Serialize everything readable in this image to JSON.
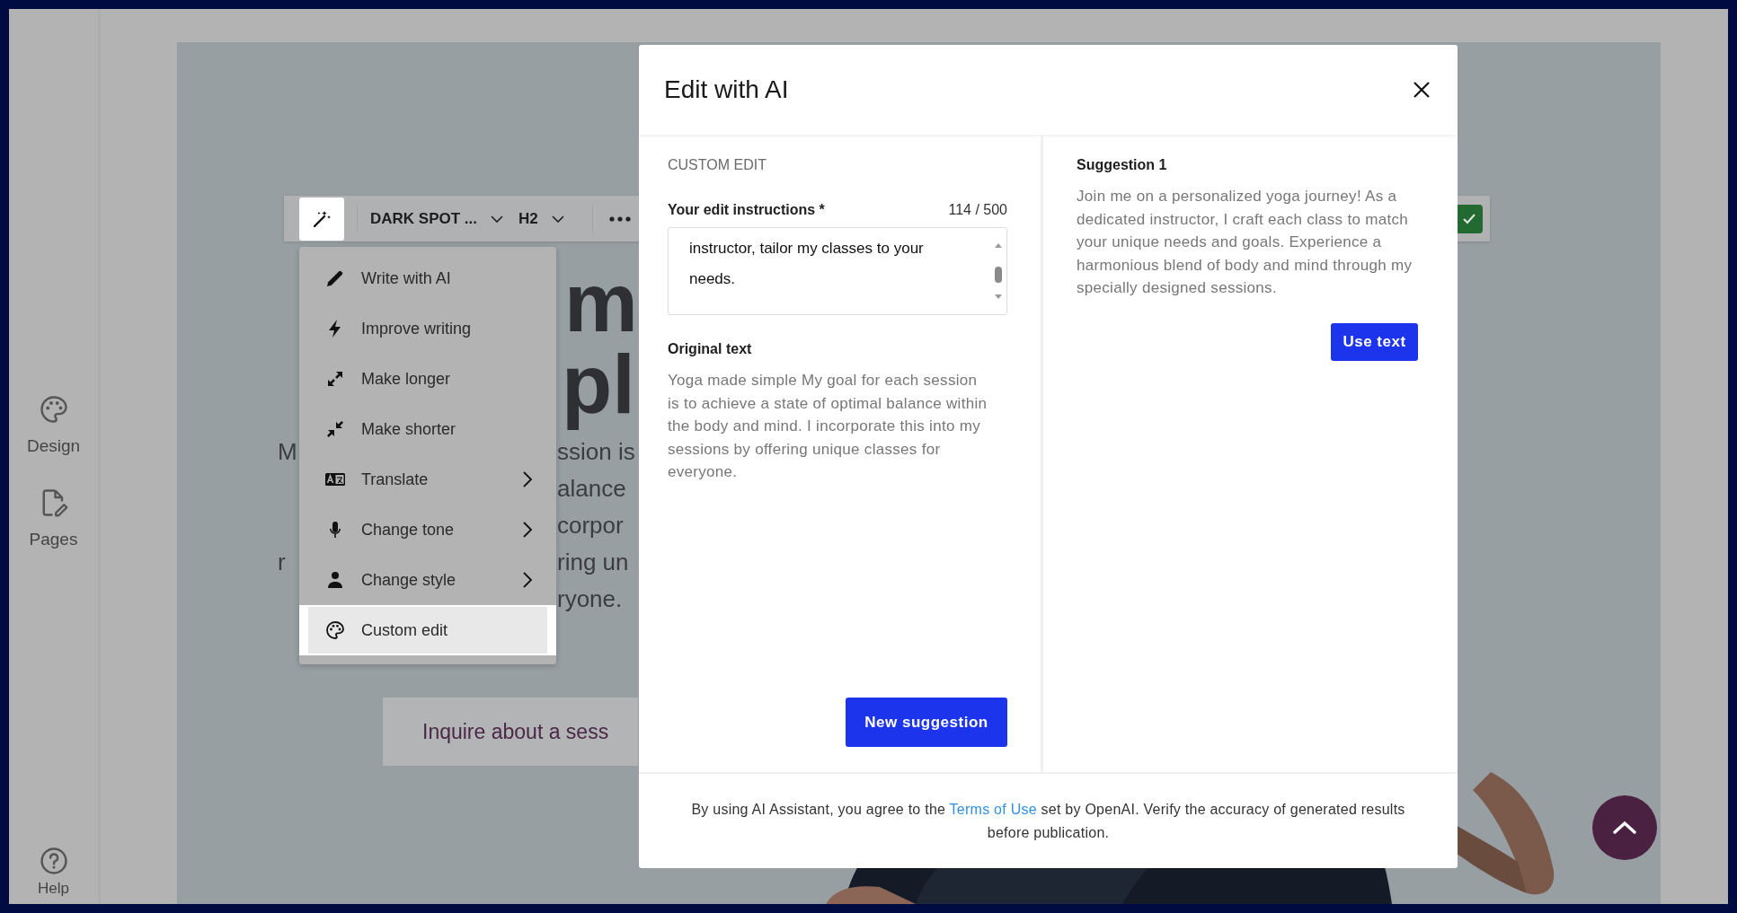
{
  "sidebar": {
    "items": [
      {
        "label": "Design"
      },
      {
        "label": "Pages"
      }
    ],
    "help": {
      "label": "Help"
    }
  },
  "page_preview": {
    "heading_fragments": [
      "m",
      "pl"
    ],
    "paragraph_lines": [
      {
        "left": "M",
        "right": "ssion is"
      },
      {
        "right": "alance"
      },
      {
        "right": "corpor"
      },
      {
        "left": "r",
        "right": "ring un"
      },
      {
        "right": "ryone."
      }
    ],
    "button": "Inquire about a sess"
  },
  "toolbar": {
    "ai_active": true,
    "font": "DARK SPOT ...",
    "heading_level": "H2"
  },
  "ai_menu": {
    "items": [
      {
        "label": "Write with AI",
        "submenu": false,
        "selected": false
      },
      {
        "label": "Improve writing",
        "submenu": false,
        "selected": false
      },
      {
        "label": "Make longer",
        "submenu": false,
        "selected": false
      },
      {
        "label": "Make shorter",
        "submenu": false,
        "selected": false
      },
      {
        "label": "Translate",
        "submenu": true,
        "selected": false
      },
      {
        "label": "Change tone",
        "submenu": true,
        "selected": false
      },
      {
        "label": "Change style",
        "submenu": true,
        "selected": false
      },
      {
        "label": "Custom edit",
        "submenu": false,
        "selected": true
      }
    ]
  },
  "modal": {
    "title": "Edit with AI",
    "section": "CUSTOM EDIT",
    "instructions": {
      "label": "Your edit instructions *",
      "counter": "114 / 500",
      "value": "instructor, tailor my classes to your needs."
    },
    "original": {
      "heading": "Original text",
      "text": "Yoga made simple My goal for each session is to achieve a state of optimal balance within the body and mind. I incorporate this into my sessions by offering unique classes for everyone."
    },
    "new_button": "New suggestion",
    "suggestion": {
      "heading": "Suggestion 1",
      "text": "Join me on a personalized yoga journey! As a dedicated instructor, I craft each class to match your unique needs and goals. Experience a harmonious blend of body and mind through my specially designed sessions.",
      "button": "Use text"
    },
    "footer": {
      "before": "By using AI Assistant, you agree to the ",
      "link": "Terms of Use",
      "after": " set by OpenAI. Verify the accuracy of generated results before publication."
    }
  }
}
